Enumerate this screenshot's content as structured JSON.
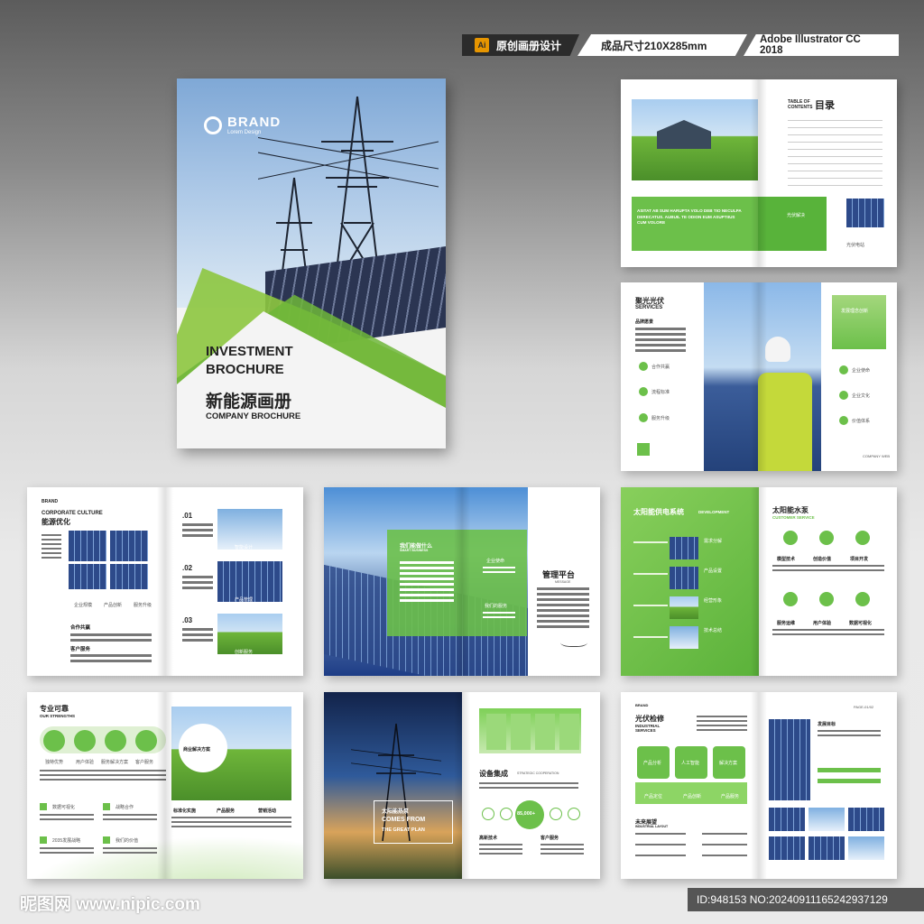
{
  "tags": {
    "ai_icon": "Ai",
    "design": "原创画册设计",
    "size": "成品尺寸210X285mm",
    "software": "Adobe Illustrator CC 2018"
  },
  "cover": {
    "brand": "BRAND",
    "brand_sub": "Lorem Design",
    "title_line1": "INVESTMENT",
    "title_line2": "BROCHURE",
    "title_cn": "新能源画册",
    "subtitle": "COMPANY BROCHURE"
  },
  "spread_toc": {
    "toc_label": "TABLE OF CONTENTS",
    "toc_cn": "目录",
    "green_text": "ASITAT AB SUM HARUPTA VOLO DEB TIO NECULPA DERECATUS. AUBUIL TE ODION EUM ASUPTIIUS CUM VOLORE",
    "caption1": "光伏解决",
    "caption2": "光伏电站"
  },
  "spread_services": {
    "title_cn": "聚光光伏",
    "title_en": "SERVICES",
    "subtitle": "品牌愿景",
    "item1": "合作共赢",
    "item2": "流程标准",
    "item3": "服务升级",
    "right_box": "发展理念创新",
    "r1": "企业使命",
    "r2": "企业文化",
    "r3": "价值体系",
    "footer": "COMPANY WEB"
  },
  "spread_culture": {
    "brand": "BRAND",
    "title_en": "CORPORATE CULTURE",
    "title_cn": "能源优化",
    "s1": "企业规模",
    "s2": "产品创新",
    "s3": "服务升级",
    "h1": "合作共赢",
    "h2": "客户服务",
    "n1": ".01",
    "n2": ".02",
    "n3": ".03",
    "c1": "智能设计",
    "c2": "产品管理",
    "c3": "创新服务"
  },
  "spread_platform": {
    "box_title": "我们能做什么",
    "box_sub": "SMART BUSINESS",
    "m1": "企业使命",
    "m2": "我们的服务",
    "title": "管理平台",
    "sub": "MESSAGE"
  },
  "spread_supply": {
    "title_cn": "太阳能供电系统",
    "title_en": "DEVELOPMENT",
    "l1": "需求分解",
    "l2": "产品设置",
    "l3": "经营形象",
    "l4": "技术总结",
    "r_title": "太阳能水泵",
    "r_sub": "CUSTOMER SERVICE",
    "g1": "模型技术",
    "g2": "创造价值",
    "g3": "项目开发",
    "g4": "服务运维",
    "g5": "用户体验",
    "g6": "数据可视化"
  },
  "spread_reliable": {
    "title_cn": "专业可靠",
    "title_en": "OUR STRENGTHS",
    "i1": "独特优势",
    "i2": "用户体验",
    "i3": "服务解决方案",
    "i4": "客户服务",
    "b1": "数据可视化",
    "b2": "战略合作",
    "b3": "2035发展战略",
    "b4": "我们的价值",
    "badge": "商业解决方案",
    "c1": "标准化实施",
    "c2": "产品服务",
    "c3": "营销活动"
  },
  "spread_equip": {
    "overlay1": "太阳能热泵",
    "overlay2": "COMES FROM",
    "overlay3": "THE GREAT PLAN",
    "title": "设备集成",
    "sub": "STRATEGIC COOPERATION",
    "stat": "85,000+",
    "left_bottom": "高新技术",
    "right_bottom": "客户服务"
  },
  "spread_repair": {
    "brand": "BRAND",
    "title_cn": "光伏检修",
    "title_en": "INDUSTRIAL SERVICES",
    "box1": "产品分析",
    "box2": "人工智能",
    "box3": "解决方案",
    "f1": "产品定位",
    "f2": "产品创新",
    "f3": "产品服务",
    "future_cn": "未来展望",
    "future_en": "INDUSTRIAL LAYOUT",
    "page": "PAGE-01/02",
    "goal": "发展目标"
  },
  "watermark": {
    "left": "昵图网 www.nipic.com",
    "right": "ID:948153 NO:20240911165242937129"
  }
}
